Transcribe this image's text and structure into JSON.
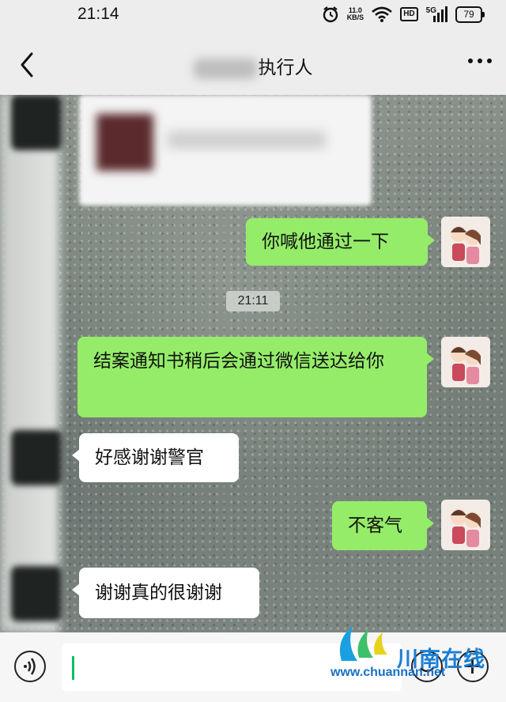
{
  "status_bar": {
    "time": "21:14",
    "network_speed_value": "11.0",
    "network_speed_unit": "KB/S",
    "hd_label": "HD",
    "network_type": "5G",
    "battery": "79",
    "icons": [
      "alarm-icon",
      "wifi-icon",
      "signal-icon",
      "battery-icon"
    ]
  },
  "header": {
    "title": "执行人",
    "title_prefix_redacted": true,
    "icons": [
      "back-arrow-icon",
      "more-dots-icon"
    ]
  },
  "messages": [
    {
      "type": "card",
      "side": "left",
      "redacted": true
    },
    {
      "type": "text",
      "side": "right",
      "text": "你喊他通过一下"
    },
    {
      "type": "timestamp",
      "text": "21:11"
    },
    {
      "type": "text",
      "side": "right",
      "text": "结案通知书稍后会通过微信送达给你"
    },
    {
      "type": "text",
      "side": "left",
      "text": "好感谢谢警官"
    },
    {
      "type": "text",
      "side": "right",
      "text": "不客气"
    },
    {
      "type": "text",
      "side": "left",
      "text": "谢谢真的很谢谢"
    }
  ],
  "input_bar": {
    "value": "",
    "icons": [
      "voice-icon",
      "emoji-icon",
      "plus-icon"
    ]
  },
  "watermark": {
    "name": "川南在线",
    "url": "www.chuannan.net"
  },
  "colors": {
    "bubble_green": "#95ec69",
    "bubble_white": "#ffffff",
    "watermark_blue": "#1a7fd6"
  }
}
